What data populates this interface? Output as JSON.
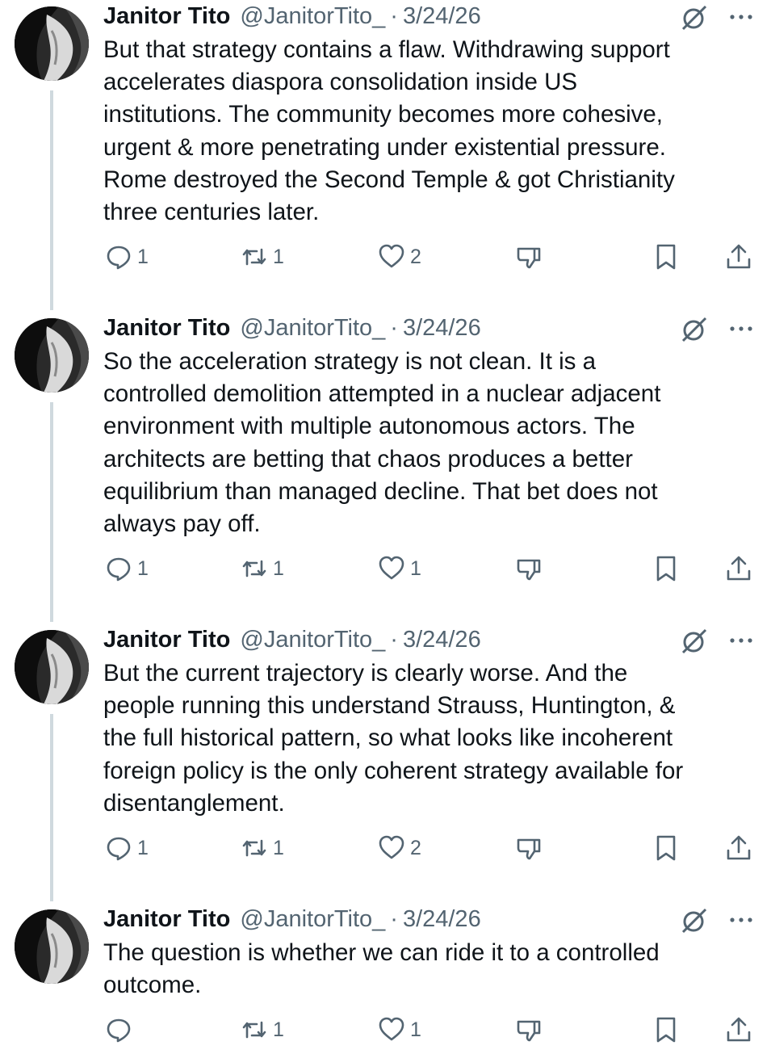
{
  "tweets": [
    {
      "author_name": "Janitor Tito",
      "handle": "@JanitorTito_",
      "separator": "·",
      "date": "3/24/26",
      "text": "But that strategy contains a flaw. Withdrawing support\naccelerates diaspora consolidation inside US\ninstitutions. The community becomes more cohesive,\nurgent & more penetrating under existential pressure.\nRome destroyed the Second Temple & got Christianity\nthree centuries later.",
      "replies": "1",
      "reposts": "1",
      "likes": "2"
    },
    {
      "author_name": "Janitor Tito",
      "handle": "@JanitorTito_",
      "separator": "·",
      "date": "3/24/26",
      "text": "So the acceleration strategy is not clean. It is a\ncontrolled demolition attempted in a nuclear adjacent\nenvironment with multiple autonomous actors. The\narchitects are betting that chaos produces a better\nequilibrium than managed decline. That bet does not\nalways pay off.",
      "replies": "1",
      "reposts": "1",
      "likes": "1"
    },
    {
      "author_name": "Janitor Tito",
      "handle": "@JanitorTito_",
      "separator": "·",
      "date": "3/24/26",
      "text": "But the current trajectory is clearly worse. And the\npeople running this understand Strauss, Huntington, &\nthe full historical pattern, so what looks like incoherent\nforeign policy is the only coherent strategy available for\ndisentanglement.",
      "replies": "1",
      "reposts": "1",
      "likes": "2"
    },
    {
      "author_name": "Janitor Tito",
      "handle": "@JanitorTito_",
      "separator": "·",
      "date": "3/24/26",
      "text": "The question is whether we can ride it to a controlled\noutcome.",
      "replies": "",
      "reposts": "1",
      "likes": "1"
    }
  ],
  "icons": {
    "reply": "reply-icon",
    "repost": "repost-icon",
    "like": "heart-icon",
    "dislike": "thumbs-down-icon",
    "bookmark": "bookmark-icon",
    "share": "share-icon",
    "grok": "grok-icon",
    "more": "more-icon"
  },
  "colors": {
    "text": "#0f1419",
    "secondary": "#536471",
    "thread_line": "#cfd9de"
  }
}
